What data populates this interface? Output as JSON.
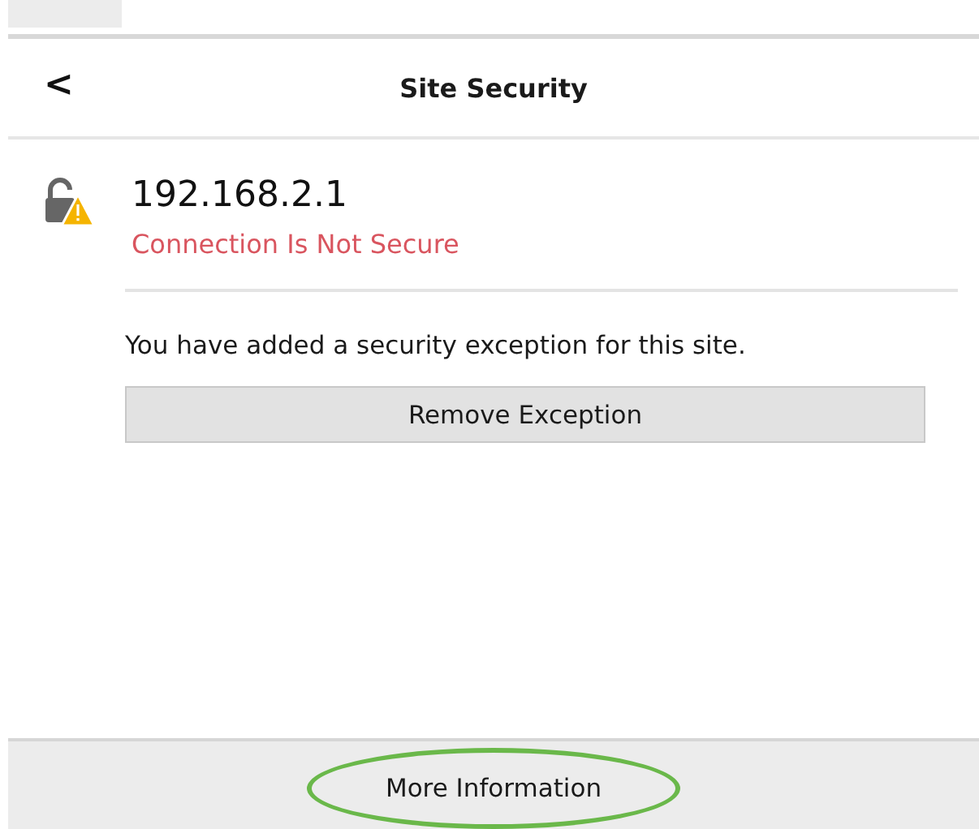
{
  "header": {
    "back": "<",
    "title": "Site Security"
  },
  "site": {
    "host": "192.168.2.1",
    "status": "Connection Is Not Secure",
    "secure": false
  },
  "message": "You have added a security exception for this site.",
  "remove_button": "Remove Exception",
  "footer": {
    "button": "More Information",
    "highlighted": true
  }
}
